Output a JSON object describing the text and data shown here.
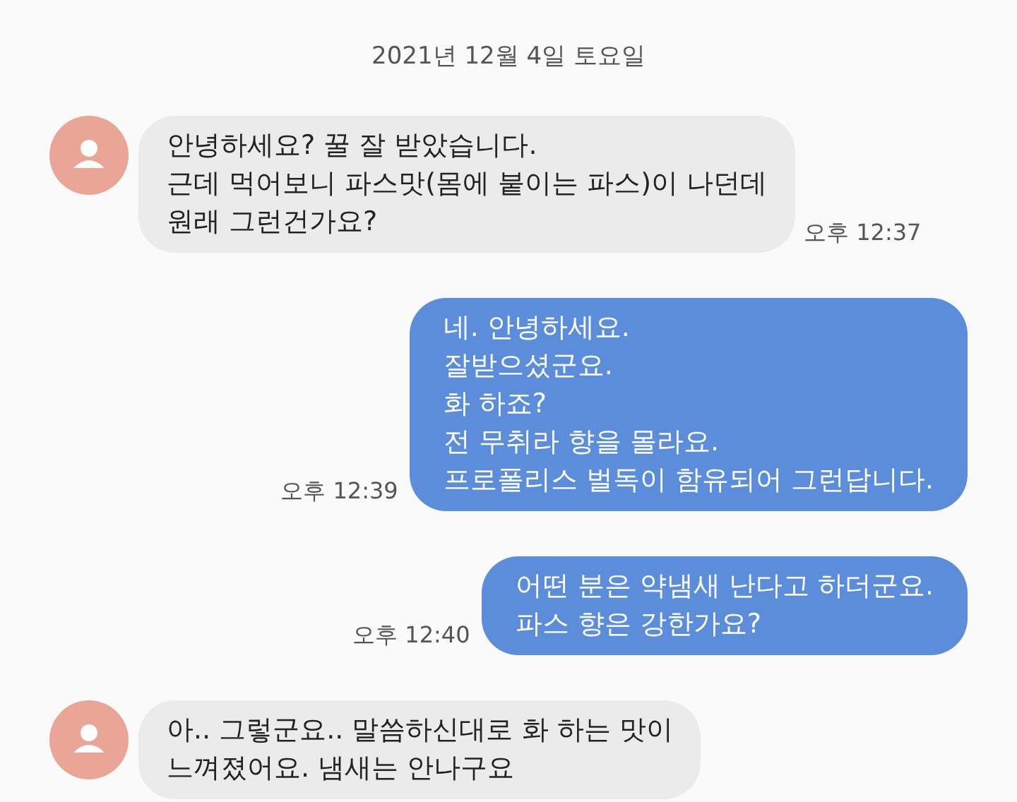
{
  "date": "2021년 12월 4일 토요일",
  "messages": [
    {
      "kind": "incoming",
      "text": "안녕하세요? 꿀 잘 받았습니다.\n근데 먹어보니 파스맛(몸에 붙이는 파스)이 나던데\n원래 그런건가요?",
      "time": "오후 12:37"
    },
    {
      "kind": "outgoing",
      "text": "네. 안녕하세요.\n잘받으셨군요.\n화 하죠?\n전 무취라 향을 몰라요.\n프로폴리스 벌독이 함유되어 그런답니다.",
      "time": "오후 12:39"
    },
    {
      "kind": "outgoing",
      "text": "어떤 분은 약냄새 난다고 하더군요.\n파스 향은 강한가요?",
      "time": "오후 12:40"
    },
    {
      "kind": "incoming",
      "text": "아.. 그렇군요.. 말씀하신대로 화 하는 맛이\n느껴졌어요. 냄새는 안나구요"
    }
  ]
}
